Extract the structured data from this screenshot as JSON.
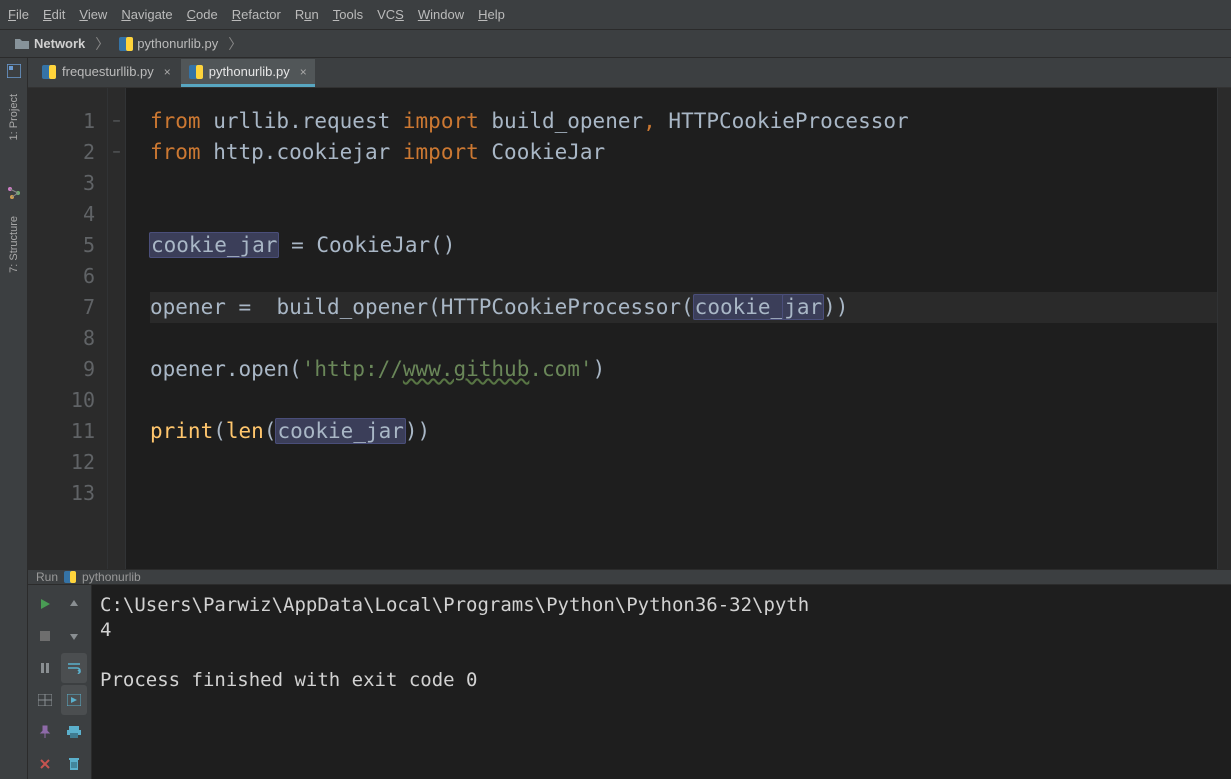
{
  "menu": {
    "items": [
      {
        "label": "File",
        "u": 0
      },
      {
        "label": "Edit",
        "u": 0
      },
      {
        "label": "View",
        "u": 0
      },
      {
        "label": "Navigate",
        "u": 0
      },
      {
        "label": "Code",
        "u": 0
      },
      {
        "label": "Refactor",
        "u": 0
      },
      {
        "label": "Run",
        "u": 1
      },
      {
        "label": "Tools",
        "u": 0
      },
      {
        "label": "VCS",
        "u": 2
      },
      {
        "label": "Window",
        "u": 0
      },
      {
        "label": "Help",
        "u": 0
      }
    ]
  },
  "breadcrumbs": {
    "project": "Network",
    "file": "pythonurlib.py"
  },
  "tabs": [
    {
      "label": "frequesturllib.py",
      "active": false
    },
    {
      "label": "pythonurlib.py",
      "active": true
    }
  ],
  "left_tabs": {
    "project": "1: Project",
    "structure": "7: Structure"
  },
  "editor": {
    "line_count": 13,
    "active_line": 7,
    "code_tokens": [
      [
        {
          "t": "from ",
          "c": "kw"
        },
        {
          "t": "urllib",
          "c": "ident"
        },
        {
          "t": ".",
          "c": "ident"
        },
        {
          "t": "request ",
          "c": "ident"
        },
        {
          "t": "import ",
          "c": "kw"
        },
        {
          "t": "build_opener",
          "c": "ident"
        },
        {
          "t": ", ",
          "c": "pun"
        },
        {
          "t": "HTTPCookieProcessor",
          "c": "ident"
        }
      ],
      [
        {
          "t": "from ",
          "c": "kw"
        },
        {
          "t": "http",
          "c": "ident"
        },
        {
          "t": ".",
          "c": "ident"
        },
        {
          "t": "cookiejar ",
          "c": "ident"
        },
        {
          "t": "import ",
          "c": "kw"
        },
        {
          "t": "CookieJar",
          "c": "ident"
        }
      ],
      [],
      [],
      [
        {
          "t": "cookie_jar",
          "c": "hl"
        },
        {
          "t": " = CookieJar()",
          "c": "ident"
        }
      ],
      [],
      [
        {
          "t": "opener =  ",
          "c": "ident"
        },
        {
          "t": "build_opener",
          "c": "ident"
        },
        {
          "t": "(HTTPCookieProcessor(",
          "c": "ident"
        },
        {
          "t": "cookie_",
          "c": "hl"
        },
        {
          "t": "",
          "c": "caret"
        },
        {
          "t": "jar",
          "c": "hl"
        },
        {
          "t": "))",
          "c": "ident"
        }
      ],
      [],
      [
        {
          "t": "opener.",
          "c": "ident"
        },
        {
          "t": "open",
          "c": "ident"
        },
        {
          "t": "(",
          "c": "ident"
        },
        {
          "t": "'http://",
          "c": "str"
        },
        {
          "t": "www.github",
          "c": "strurl"
        },
        {
          "t": ".com'",
          "c": "str"
        },
        {
          "t": ")",
          "c": "ident"
        }
      ],
      [],
      [
        {
          "t": "print",
          "c": "fn"
        },
        {
          "t": "(",
          "c": "ident"
        },
        {
          "t": "len",
          "c": "fn"
        },
        {
          "t": "(",
          "c": "ident"
        },
        {
          "t": "cookie_jar",
          "c": "hl"
        },
        {
          "t": "))",
          "c": "ident"
        }
      ],
      [],
      []
    ],
    "fold_markers": {
      "1": "−",
      "2": "−"
    }
  },
  "run": {
    "header_label": "Run",
    "config_name": "pythonurlib",
    "console_lines": [
      "C:\\Users\\Parwiz\\AppData\\Local\\Programs\\Python\\Python36-32\\pyth",
      "4",
      "",
      "Process finished with exit code 0"
    ]
  },
  "colors": {
    "keyword": "#cc7832",
    "identifier": "#a9b7c6",
    "string": "#6a8759",
    "function": "#ffc66d",
    "highlight_bg": "#3b3e59"
  }
}
